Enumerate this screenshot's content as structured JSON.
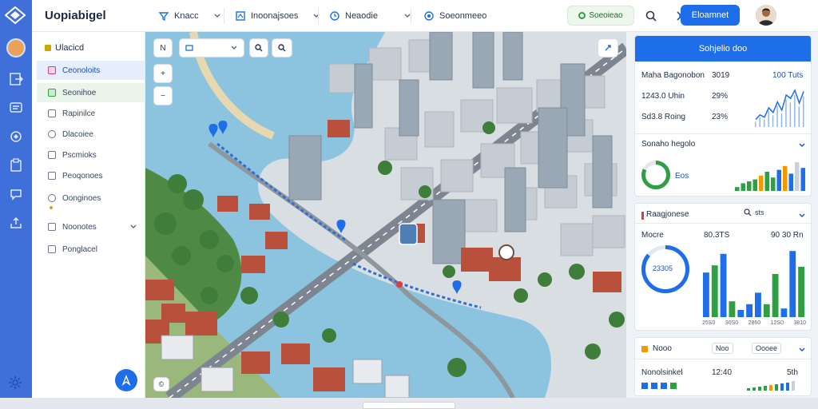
{
  "app": {
    "title": "Uopiabigel"
  },
  "topbar": {
    "selectors": [
      {
        "label": "Knacc",
        "icon": "filter-icon"
      },
      {
        "label": "Inoonajsoes",
        "icon": "layers-icon"
      },
      {
        "label": "Neaodie",
        "icon": "clock-icon"
      },
      {
        "label": "Soeonmeeo",
        "icon": "pin-icon"
      }
    ],
    "status": "Soeoieao",
    "primary_button": "Eloamnet",
    "icons": [
      "search-icon",
      "settings-sliders-icon"
    ]
  },
  "sidebar": {
    "title": "Ulacicd",
    "items": [
      {
        "label": "Ceonoloits",
        "state": "active"
      },
      {
        "label": "Seonihoe",
        "state": "highlighted"
      },
      {
        "label": "Rapinilce"
      },
      {
        "label": "Dlacoiee"
      },
      {
        "label": "Pscmioks"
      },
      {
        "label": "Peoqonoes"
      },
      {
        "label": "Oonginoes"
      },
      {
        "label": "Noonotes",
        "expandable": true
      },
      {
        "label": "Ponglacel"
      }
    ]
  },
  "map": {
    "controls": [
      "N",
      "+",
      "−"
    ],
    "search_placeholder": "",
    "attribution": "© "
  },
  "panel1": {
    "title": "Sohjelio doo",
    "rows": [
      {
        "label": "Maha Bagonobon",
        "value": "3019",
        "value2": "100 Tuts"
      },
      {
        "label": "1243.0 Uhin",
        "value": "29%"
      },
      {
        "label": "Sd3.8 Roing",
        "value": "23%"
      }
    ],
    "sparkline": [
      10,
      18,
      14,
      30,
      22,
      40,
      26,
      52,
      46,
      60,
      38,
      58
    ],
    "accent": "#1d6ee8"
  },
  "panel2": {
    "title": "Sonaho hegolo",
    "donut_percent": 82,
    "donut_label": "Eos",
    "bars": [
      4,
      8,
      10,
      12,
      16,
      20,
      14,
      22,
      26,
      18,
      30,
      24
    ],
    "bar_colors": [
      "#2ea043",
      "#2ea043",
      "#2ea043",
      "#2ea043",
      "#f29900",
      "#2ea043",
      "#2ea043",
      "#1d6ee8",
      "#f29900",
      "#1d6ee8",
      "#c7d0dc",
      "#1d6ee8"
    ]
  },
  "panel3": {
    "title": "Raagjonese",
    "action": "sts",
    "row_label": "Mocre",
    "row_value": "80.3TS",
    "row_value2": "90 30 Rn",
    "donut_label": "23305",
    "bars": [
      {
        "value": 62,
        "color": "#1d6ee8"
      },
      {
        "value": 72,
        "color": "#2ea043"
      },
      {
        "value": 88,
        "color": "#1d6ee8"
      },
      {
        "value": 22,
        "color": "#2ea043"
      },
      {
        "value": 10,
        "color": "#1d6ee8"
      },
      {
        "value": 18,
        "color": "#1d6ee8"
      },
      {
        "value": 34,
        "color": "#1d6ee8"
      },
      {
        "value": 18,
        "color": "#2ea043"
      },
      {
        "value": 60,
        "color": "#2ea043"
      },
      {
        "value": 12,
        "color": "#1d6ee8"
      },
      {
        "value": 92,
        "color": "#1d6ee8"
      },
      {
        "value": 70,
        "color": "#2ea043"
      }
    ],
    "x_labels": [
      "25S0",
      "30S0",
      "2860",
      "12S0",
      "3810"
    ]
  },
  "panel4": {
    "title": "Nooo",
    "chip1": "Noo",
    "chip2": "Oooee",
    "row_label": "Nonolsinkel",
    "row_value": "12:40",
    "row_value2": "5th"
  }
}
